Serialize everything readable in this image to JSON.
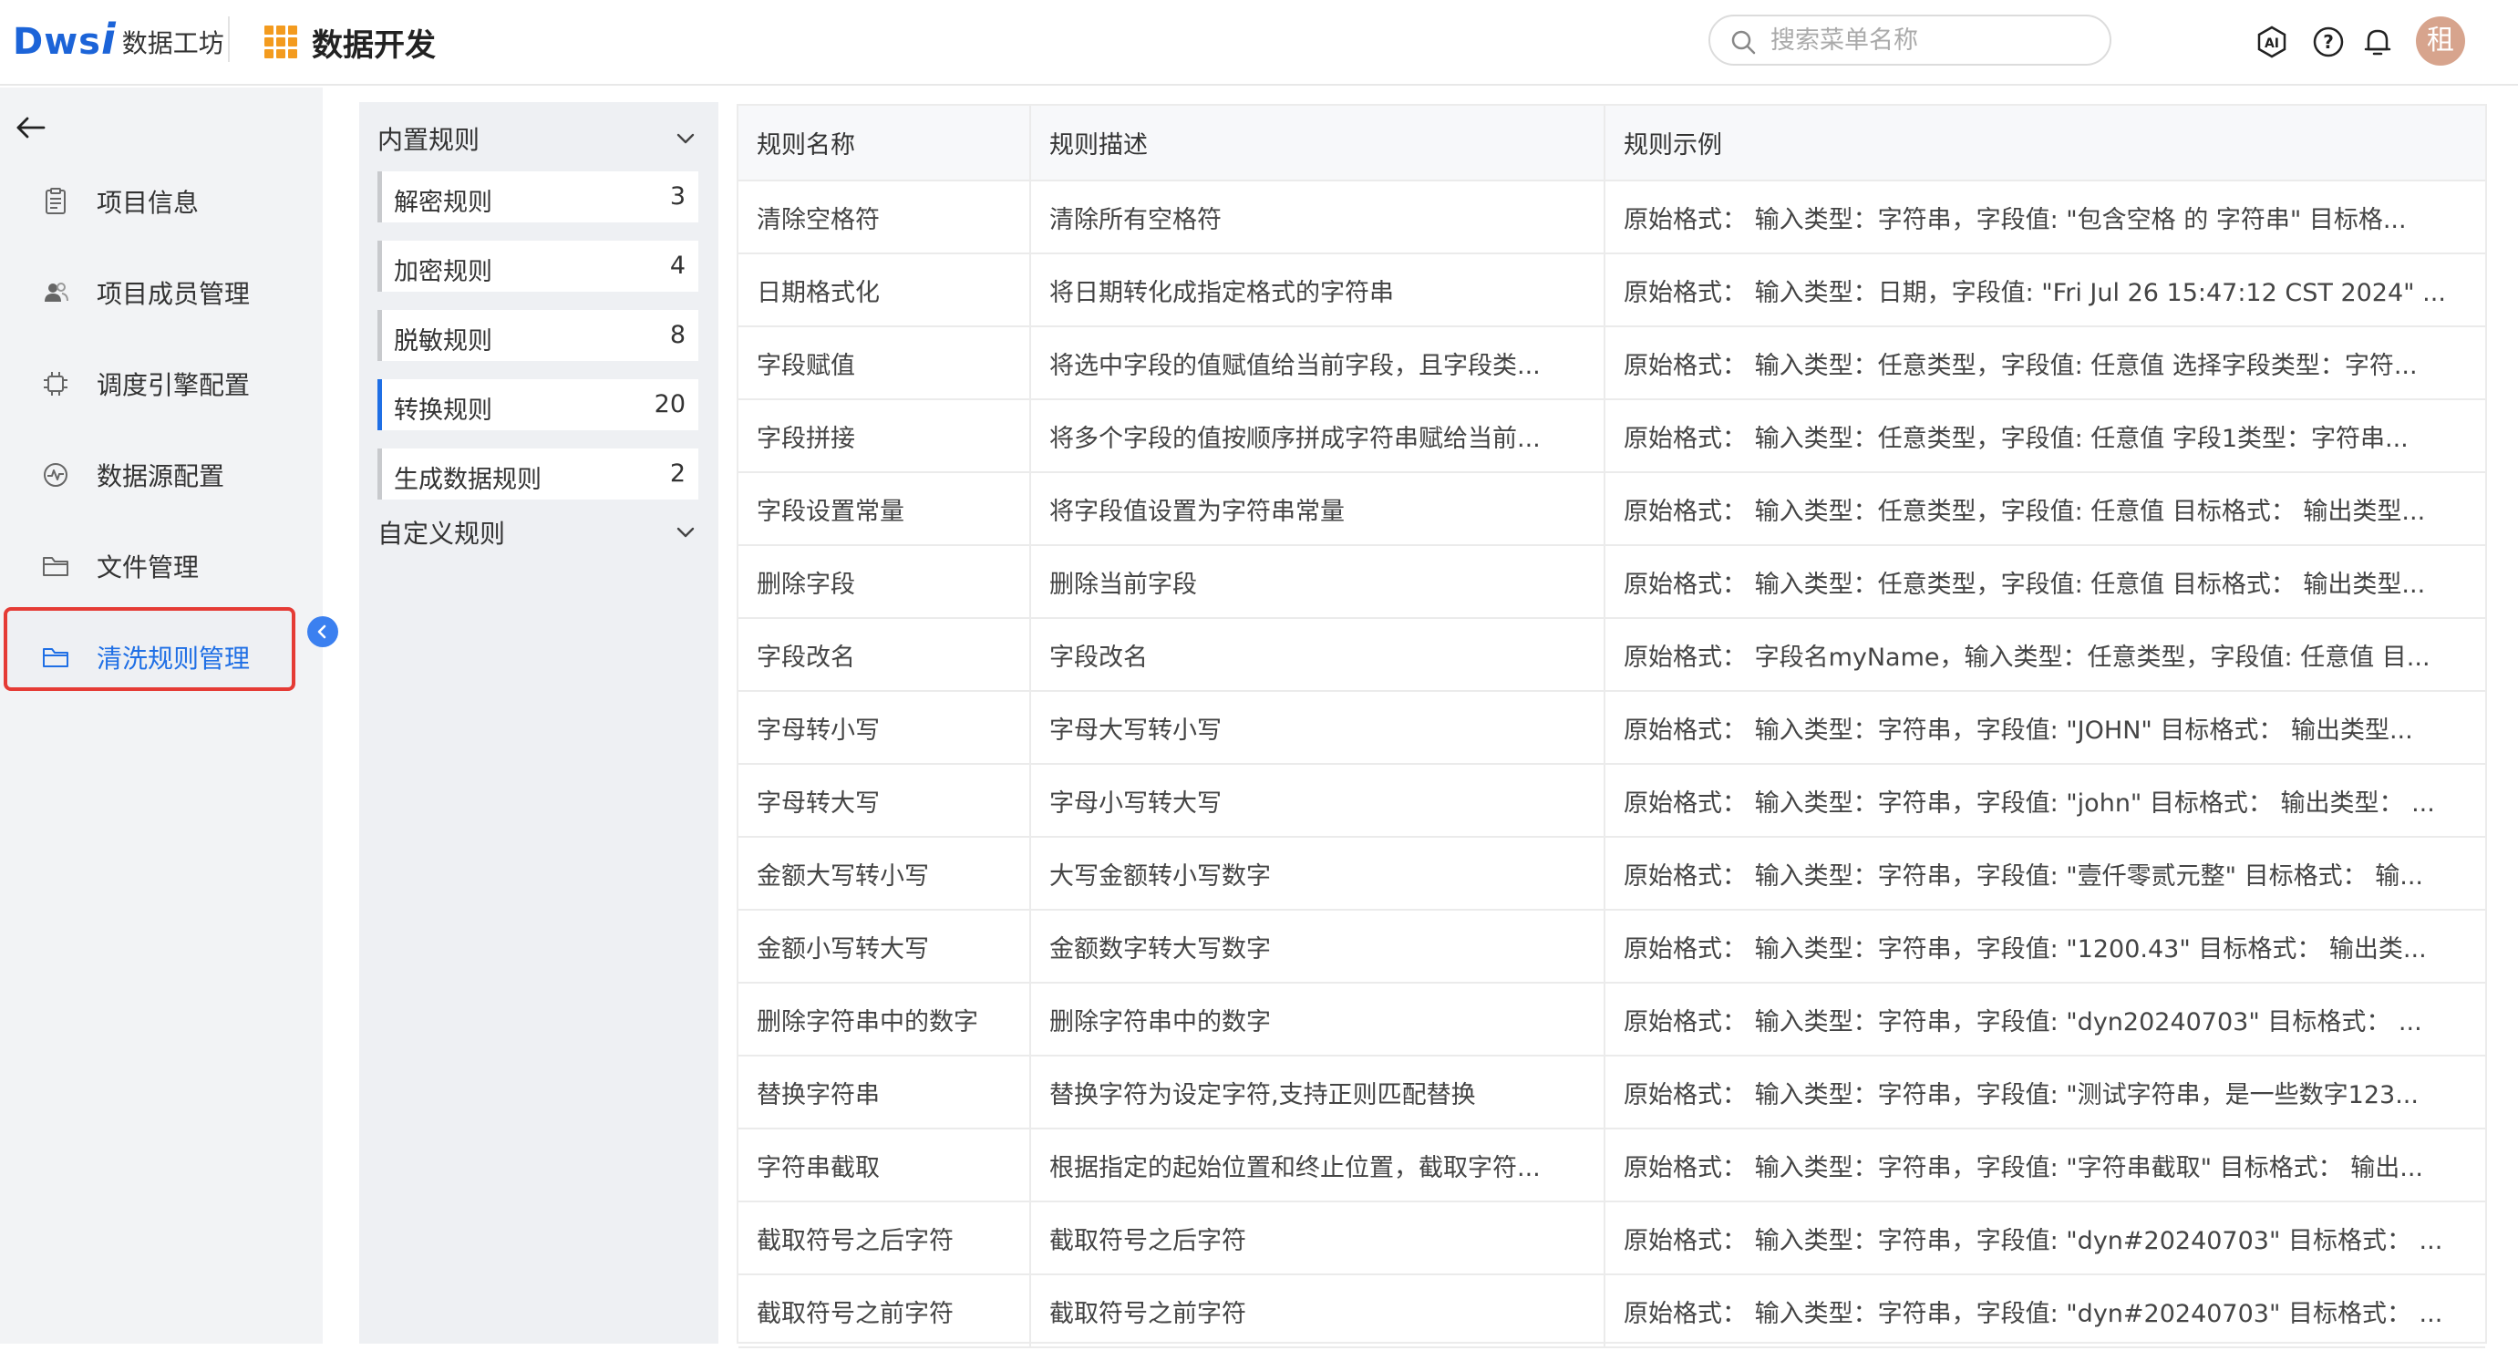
{
  "header": {
    "logo_text": "数据工坊",
    "app_title": "数据开发",
    "search_placeholder": "搜索菜单名称",
    "avatar_text": "租"
  },
  "sidebar": {
    "items": [
      {
        "label": "项目信息",
        "icon": "clipboard-icon"
      },
      {
        "label": "项目成员管理",
        "icon": "users-icon"
      },
      {
        "label": "调度引擎配置",
        "icon": "chip-icon"
      },
      {
        "label": "数据源配置",
        "icon": "datasource-icon"
      },
      {
        "label": "文件管理",
        "icon": "folder-icon"
      },
      {
        "label": "清洗规则管理",
        "icon": "folder-icon",
        "active": true
      }
    ]
  },
  "categories": {
    "builtin_label": "内置规则",
    "custom_label": "自定义规则",
    "items": [
      {
        "name": "解密规则",
        "count": "3"
      },
      {
        "name": "加密规则",
        "count": "4"
      },
      {
        "name": "脱敏规则",
        "count": "8"
      },
      {
        "name": "转换规则",
        "count": "20",
        "active": true
      },
      {
        "name": "生成数据规则",
        "count": "2"
      }
    ]
  },
  "table": {
    "columns": [
      "规则名称",
      "规则描述",
      "规则示例"
    ],
    "rows": [
      [
        "清除空格符",
        "清除所有空格符",
        "原始格式： 输入类型：字符串，字段值: \"包含空格 的 字符串\" 目标格..."
      ],
      [
        "日期格式化",
        "将日期转化成指定格式的字符串",
        "原始格式： 输入类型：日期，字段值: \"Fri Jul 26 15:47:12 CST 2024\" ..."
      ],
      [
        "字段赋值",
        "将选中字段的值赋值给当前字段，且字段类...",
        "原始格式： 输入类型：任意类型，字段值: 任意值 选择字段类型：字符..."
      ],
      [
        "字段拼接",
        "将多个字段的值按顺序拼成字符串赋给当前...",
        "原始格式： 输入类型：任意类型，字段值: 任意值 字段1类型：字符串..."
      ],
      [
        "字段设置常量",
        "将字段值设置为字符串常量",
        "原始格式： 输入类型：任意类型，字段值: 任意值 目标格式： 输出类型..."
      ],
      [
        "删除字段",
        "删除当前字段",
        "原始格式： 输入类型：任意类型，字段值: 任意值 目标格式： 输出类型..."
      ],
      [
        "字段改名",
        "字段改名",
        "原始格式： 字段名myName，输入类型：任意类型，字段值: 任意值 目..."
      ],
      [
        "字母转小写",
        "字母大写转小写",
        "原始格式： 输入类型：字符串，字段值: \"JOHN\" 目标格式： 输出类型..."
      ],
      [
        "字母转大写",
        "字母小写转大写",
        "原始格式： 输入类型：字符串，字段值: \"john\" 目标格式： 输出类型： ..."
      ],
      [
        "金额大写转小写",
        "大写金额转小写数字",
        "原始格式： 输入类型：字符串，字段值: \"壹仟零贰元整\" 目标格式： 输..."
      ],
      [
        "金额小写转大写",
        "金额数字转大写数字",
        "原始格式： 输入类型：字符串，字段值: \"1200.43\" 目标格式： 输出类..."
      ],
      [
        "删除字符串中的数字",
        "删除字符串中的数字",
        "原始格式： 输入类型：字符串，字段值: \"dyn20240703\" 目标格式： ..."
      ],
      [
        "替换字符串",
        "替换字符为设定字符,支持正则匹配替换",
        "原始格式： 输入类型：字符串，字段值: \"测试字符串，是一些数字123..."
      ],
      [
        "字符串截取",
        "根据指定的起始位置和终止位置，截取字符...",
        "原始格式： 输入类型：字符串，字段值: \"字符串截取\" 目标格式： 输出..."
      ],
      [
        "截取符号之后字符",
        "截取符号之后字符",
        "原始格式： 输入类型：字符串，字段值: \"dyn#20240703\" 目标格式： ..."
      ],
      [
        "截取符号之前字符",
        "截取符号之前字符",
        "原始格式： 输入类型：字符串，字段值: \"dyn#20240703\" 目标格式： ..."
      ]
    ]
  },
  "colors": {
    "accent": "#1f6fe5",
    "highlight_border": "#e53b35",
    "logo_grid": "#f39b1f",
    "avatar_bg": "#d7a48d"
  }
}
